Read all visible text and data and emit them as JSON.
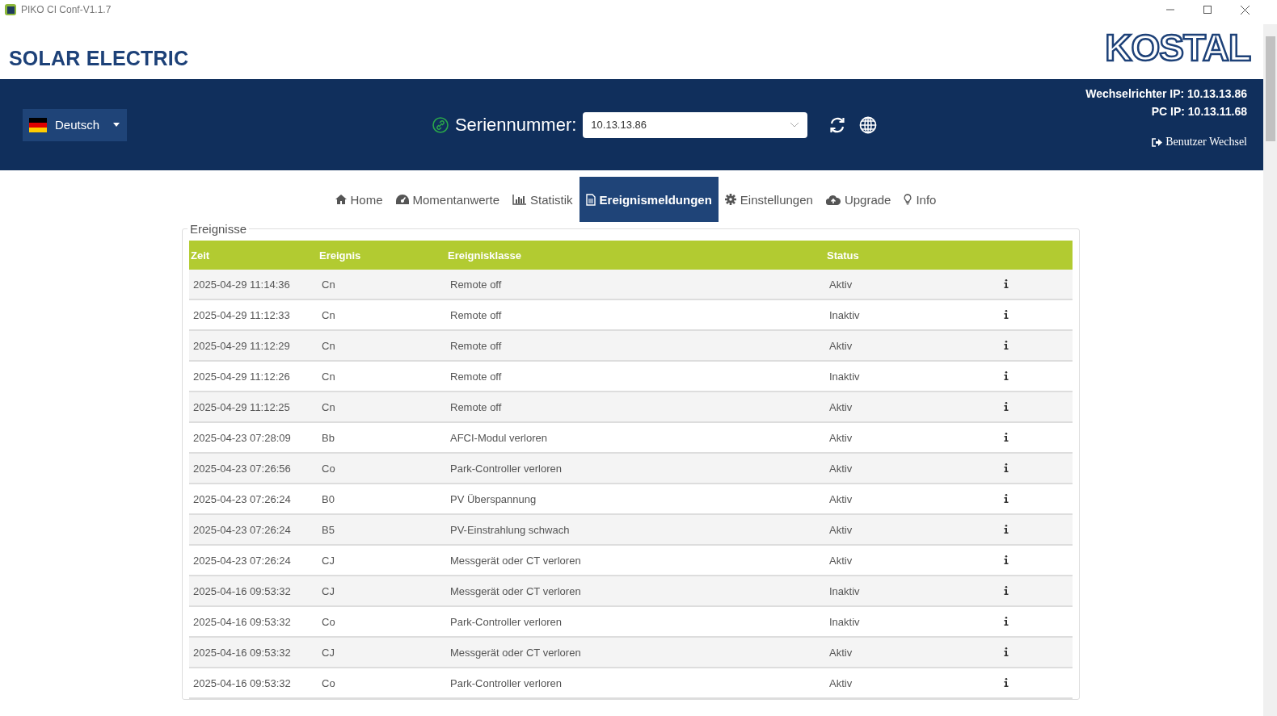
{
  "window": {
    "title": "PIKO CI Conf-V1.1.7"
  },
  "header": {
    "brand": "SOLAR ELECTRIC",
    "logo": "KOSTAL"
  },
  "toolbar": {
    "language": "Deutsch",
    "serial_label": "Seriennummer:",
    "serial_value": "10.13.13.86",
    "inverter_ip": "Wechselrichter IP: 10.13.13.86",
    "pc_ip": "PC IP: 10.13.11.68",
    "user_switch": "Benutzer Wechsel"
  },
  "nav": [
    {
      "label": "Home",
      "kind": "home",
      "selected": false
    },
    {
      "label": "Momentanwerte",
      "kind": "gauge",
      "selected": false
    },
    {
      "label": "Statistik",
      "kind": "chart",
      "selected": false
    },
    {
      "label": "Ereignismeldungen",
      "kind": "document",
      "selected": true
    },
    {
      "label": "Einstellungen",
      "kind": "gear",
      "selected": false
    },
    {
      "label": "Upgrade",
      "kind": "cloud",
      "selected": false
    },
    {
      "label": "Info",
      "kind": "bulb",
      "selected": false
    }
  ],
  "events": {
    "legend": "Ereignisse",
    "columns": [
      "Zeit",
      "Ereignis",
      "Ereignisklasse",
      "Status"
    ],
    "rows": [
      {
        "time": "2025-04-29 11:14:36",
        "event": "Cn",
        "class": "Remote off",
        "status": "Aktiv"
      },
      {
        "time": "2025-04-29 11:12:33",
        "event": "Cn",
        "class": "Remote off",
        "status": "Inaktiv"
      },
      {
        "time": "2025-04-29 11:12:29",
        "event": "Cn",
        "class": "Remote off",
        "status": "Aktiv"
      },
      {
        "time": "2025-04-29 11:12:26",
        "event": "Cn",
        "class": "Remote off",
        "status": "Inaktiv"
      },
      {
        "time": "2025-04-29 11:12:25",
        "event": "Cn",
        "class": "Remote off",
        "status": "Aktiv"
      },
      {
        "time": "2025-04-23 07:28:09",
        "event": "Bb",
        "class": "AFCI-Modul verloren",
        "status": "Aktiv"
      },
      {
        "time": "2025-04-23 07:26:56",
        "event": "Co",
        "class": "Park-Controller verloren",
        "status": "Aktiv"
      },
      {
        "time": "2025-04-23 07:26:24",
        "event": "B0",
        "class": "PV Überspannung",
        "status": "Aktiv"
      },
      {
        "time": "2025-04-23 07:26:24",
        "event": "B5",
        "class": "PV-Einstrahlung schwach",
        "status": "Aktiv"
      },
      {
        "time": "2025-04-23 07:26:24",
        "event": "CJ",
        "class": "Messgerät oder CT verloren",
        "status": "Aktiv"
      },
      {
        "time": "2025-04-16 09:53:32",
        "event": "CJ",
        "class": "Messgerät oder CT verloren",
        "status": "Inaktiv"
      },
      {
        "time": "2025-04-16 09:53:32",
        "event": "Co",
        "class": "Park-Controller verloren",
        "status": "Inaktiv"
      },
      {
        "time": "2025-04-16 09:53:32",
        "event": "CJ",
        "class": "Messgerät oder CT verloren",
        "status": "Aktiv"
      },
      {
        "time": "2025-04-16 09:53:32",
        "event": "Co",
        "class": "Park-Controller verloren",
        "status": "Aktiv"
      }
    ]
  }
}
